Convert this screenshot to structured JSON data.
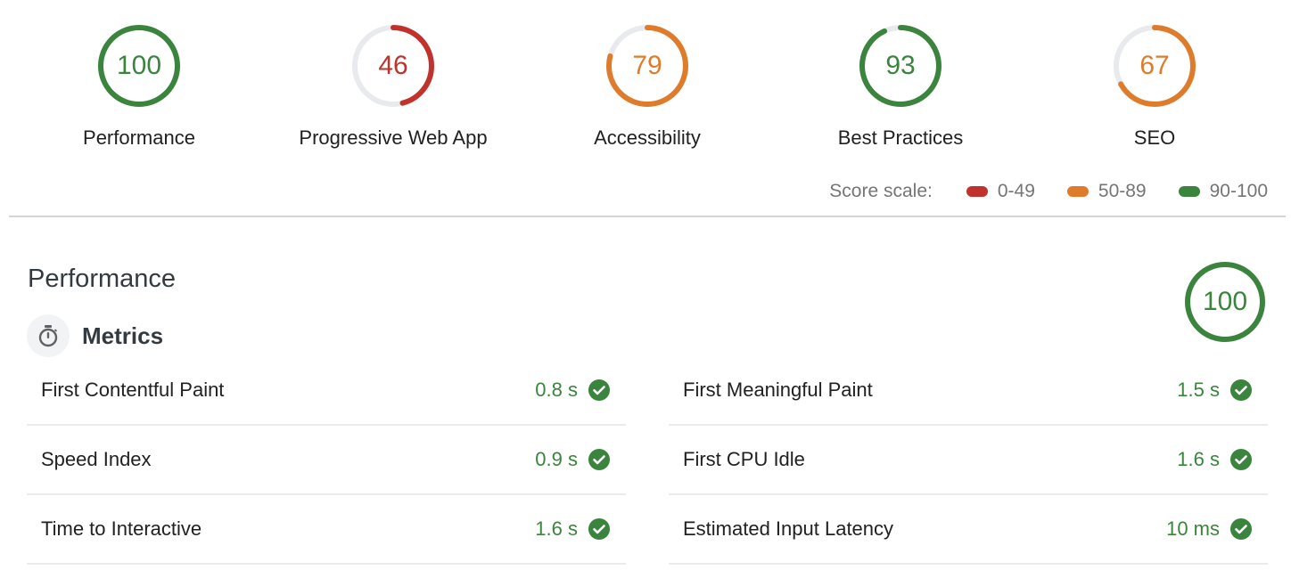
{
  "colors": {
    "pass": "#3b843d",
    "average": "#de7c2c",
    "fail": "#c0322b",
    "track": "#e8eaed"
  },
  "gauges": [
    {
      "label": "Performance",
      "score": 100,
      "color": "#3b843d"
    },
    {
      "label": "Progressive Web App",
      "score": 46,
      "color": "#c0322b"
    },
    {
      "label": "Accessibility",
      "score": 79,
      "color": "#de7c2c"
    },
    {
      "label": "Best Practices",
      "score": 93,
      "color": "#3b843d"
    },
    {
      "label": "SEO",
      "score": 67,
      "color": "#de7c2c"
    }
  ],
  "score_scale": {
    "label": "Score scale:",
    "ranges": [
      {
        "label": "0-49",
        "color": "#c0322b"
      },
      {
        "label": "50-89",
        "color": "#de7c2c"
      },
      {
        "label": "90-100",
        "color": "#3b843d"
      }
    ]
  },
  "category": {
    "title": "Performance",
    "score": 100,
    "color": "#3b843d",
    "group_title": "Metrics",
    "group_icon": "stopwatch-icon"
  },
  "metrics": {
    "left": [
      {
        "name": "First Contentful Paint",
        "value": "0.8 s",
        "status": "pass"
      },
      {
        "name": "Speed Index",
        "value": "0.9 s",
        "status": "pass"
      },
      {
        "name": "Time to Interactive",
        "value": "1.6 s",
        "status": "pass"
      }
    ],
    "right": [
      {
        "name": "First Meaningful Paint",
        "value": "1.5 s",
        "status": "pass"
      },
      {
        "name": "First CPU Idle",
        "value": "1.6 s",
        "status": "pass"
      },
      {
        "name": "Estimated Input Latency",
        "value": "10 ms",
        "status": "pass"
      }
    ]
  }
}
